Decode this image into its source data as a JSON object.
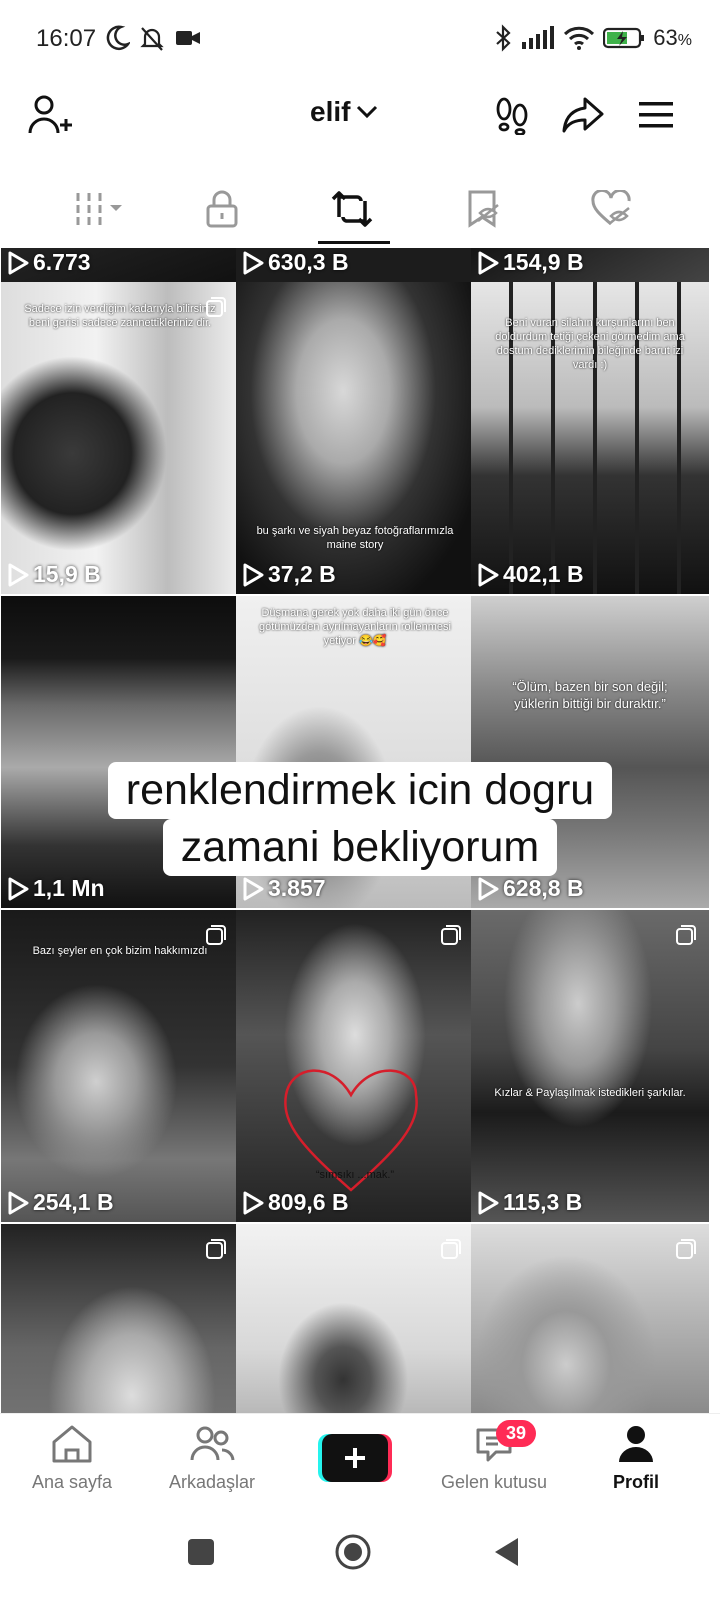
{
  "status": {
    "time": "16:07",
    "battery": "63",
    "battery_unit": "%"
  },
  "header": {
    "username": "elif"
  },
  "tiles": [
    {
      "views": "6.773",
      "caption": "",
      "multi": false
    },
    {
      "views": "630,3 B",
      "caption": "",
      "multi": false
    },
    {
      "views": "154,9 B",
      "caption": "",
      "multi": false
    },
    {
      "views": "15,9 B",
      "caption": "Sadece izin verdiğim kadarıyla bilirsiniz beni gerisi sadece zannettikleriniz dir.",
      "multi": true
    },
    {
      "views": "37,2 B",
      "caption": "bu şarkı ve siyah beyaz fotoğraflarımızla maine story",
      "multi": false
    },
    {
      "views": "402,1 B",
      "caption": "Beni vuran silahın kurşunlarını ben doldurdum tetiği çekeni görmedim ama dostum dediklerimin bileğinde barut izi vardı :)",
      "multi": false
    },
    {
      "views": "1,1 Mn",
      "caption": "",
      "multi": false
    },
    {
      "views": "3.857",
      "caption": "Düşmana gerek yok daha iki gün önce götümüzden ayrılmayanların rollenmesi yetiyor 😂🥰",
      "multi": false
    },
    {
      "views": "628,8 B",
      "caption": "“Ölüm, bazen bir son değil; yüklerin bittiği bir duraktır.”",
      "multi": false
    },
    {
      "views": "254,1 B",
      "caption": "Bazı şeyler en çok bizim hakkımızdı",
      "multi": true
    },
    {
      "views": "809,6 B",
      "caption": "“sımsıkı ...mak.”",
      "multi": true
    },
    {
      "views": "115,3 B",
      "caption": "Kızlar & Paylaşılmak istedikleri şarkılar.",
      "multi": true
    },
    {
      "views": "",
      "caption": "",
      "multi": true
    },
    {
      "views": "",
      "caption": "",
      "multi": true
    },
    {
      "views": "",
      "caption": "",
      "multi": true
    }
  ],
  "overlay": {
    "line1": "renklendirmek icin dogru",
    "line2": "zamani bekliyorum"
  },
  "nav": {
    "home": "Ana sayfa",
    "friends": "Arkadaşlar",
    "inbox": "Gelen kutusu",
    "inbox_badge": "39",
    "profile": "Profil"
  },
  "colors": {
    "accent": "#ff2b55",
    "cyan": "#25f4ee",
    "text": "#111111",
    "muted": "#777777"
  },
  "icons": {
    "add_friend": "person-plus-icon",
    "footprints": "footprints-icon",
    "share": "share-arrow-icon",
    "menu": "hamburger-menu-icon"
  }
}
